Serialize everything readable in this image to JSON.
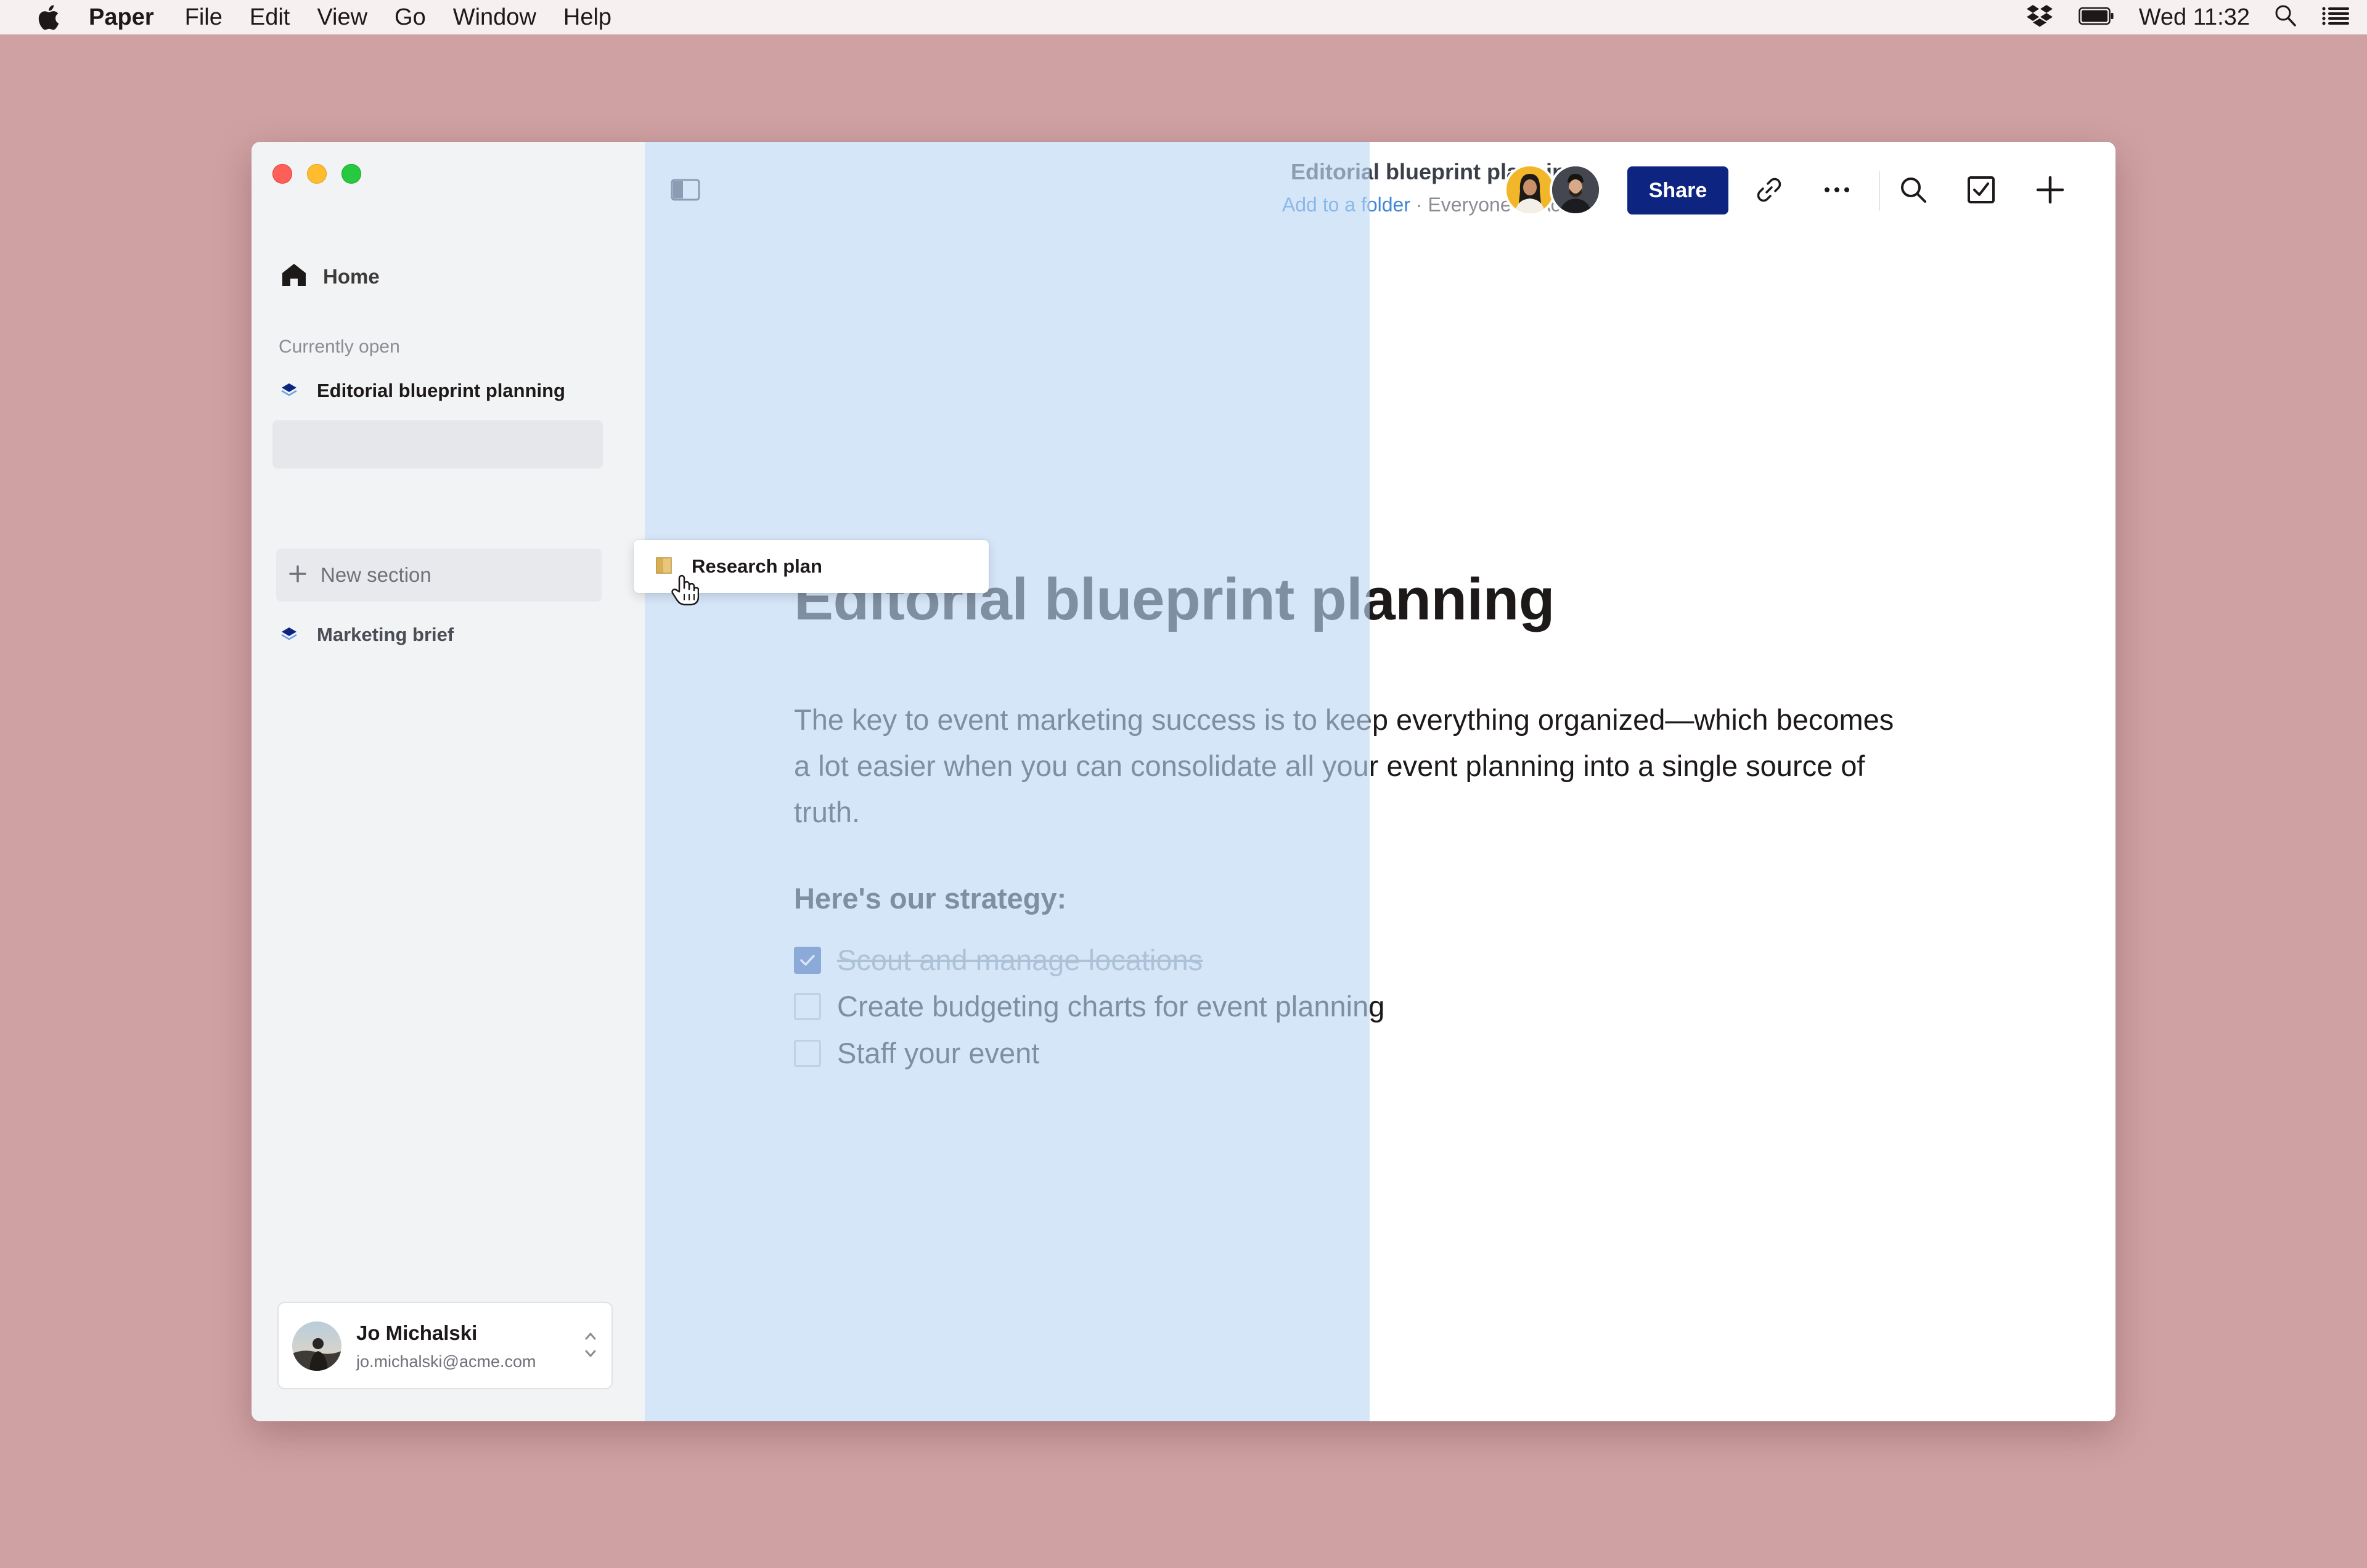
{
  "menubar": {
    "app_name": "Paper",
    "items": [
      "File",
      "Edit",
      "View",
      "Go",
      "Window",
      "Help"
    ],
    "clock": "Wed 11:32",
    "status_icons": [
      "dropbox-icon",
      "battery-icon",
      "spotlight-search-icon",
      "control-center-list-icon"
    ]
  },
  "sidebar": {
    "home_label": "Home",
    "section_label": "Currently open",
    "docs": [
      {
        "label": "Editorial blueprint planning",
        "icon": "paper-doc-icon"
      },
      {
        "label": "Marketing brief",
        "icon": "paper-doc-icon"
      }
    ],
    "new_section_label": "New section",
    "drag_item": {
      "label": "Research plan",
      "icon": "folder-icon"
    },
    "user": {
      "name": "Jo Michalski",
      "email": "jo.michalski@acme.com"
    }
  },
  "header": {
    "title": "Editorial blueprint planning",
    "folder_link": "Add to a folder",
    "separator": " · ",
    "audience": "Everyone at Acme",
    "share_label": "Share",
    "toolbar_icons": [
      "copy-link-icon",
      "more-options-icon",
      "search-icon",
      "checklist-icon",
      "create-new-icon"
    ]
  },
  "document": {
    "title": "Editorial blueprint planning",
    "body": "The key to event marketing success is to keep everything organized—which becomes a lot easier when you can consolidate all your event planning into a single source of truth.",
    "strategy_heading": "Here's our strategy:",
    "tasks": [
      {
        "label": "Scout and manage locations ",
        "done": true
      },
      {
        "label": "Create budgeting charts for event planning",
        "done": false
      },
      {
        "label": "Staff your event",
        "done": false
      }
    ]
  },
  "colors": {
    "desktop": "#cfa1a3",
    "sidebar": "#f2f3f5",
    "highlight_band": "#d4e5f7",
    "share_button": "#0d2481",
    "link": "#3f86d8",
    "checkbox_checked": "#3f62a8"
  }
}
